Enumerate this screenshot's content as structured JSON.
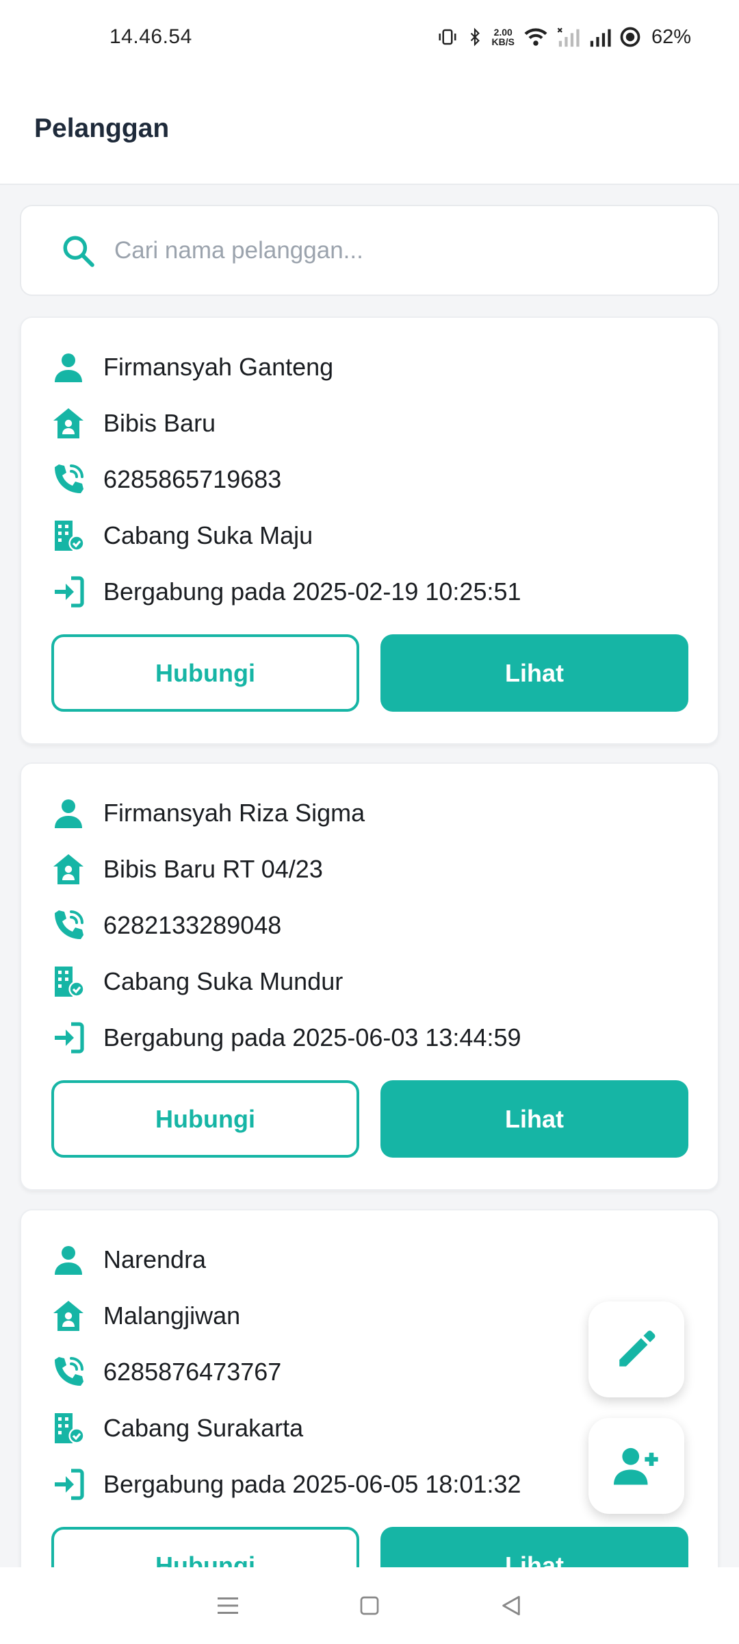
{
  "status_bar": {
    "time": "14.46.54",
    "net_speed_value": "2.00",
    "net_speed_unit": "KB/S",
    "battery": "62%"
  },
  "header": {
    "title": "Pelanggan"
  },
  "search": {
    "placeholder": "Cari nama pelanggan...",
    "value": ""
  },
  "colors": {
    "accent": "#16b5a5",
    "text": "#1a1d21",
    "placeholder": "#9ba3ad"
  },
  "icons": {
    "name": "person-icon",
    "address": "home-user-icon",
    "phone": "phone-call-icon",
    "branch": "building-check-icon",
    "joined": "sign-in-icon",
    "fab_edit": "pencil-icon",
    "fab_add": "add-user-icon"
  },
  "customers": [
    {
      "name": "Firmansyah Ganteng",
      "address": "Bibis Baru",
      "phone": "6285865719683",
      "branch": "Cabang Suka Maju",
      "joined": "Bergabung pada 2025-02-19 10:25:51",
      "contact_label": "Hubungi",
      "view_label": "Lihat"
    },
    {
      "name": "Firmansyah Riza Sigma",
      "address": "Bibis Baru RT 04/23",
      "phone": "6282133289048",
      "branch": "Cabang Suka Mundur",
      "joined": "Bergabung pada 2025-06-03 13:44:59",
      "contact_label": "Hubungi",
      "view_label": "Lihat"
    },
    {
      "name": "Narendra",
      "address": "Malangjiwan",
      "phone": "6285876473767",
      "branch": "Cabang Surakarta",
      "joined": "Bergabung pada 2025-06-05 18:01:32",
      "contact_label": "Hubungi",
      "view_label": "Lihat"
    }
  ]
}
